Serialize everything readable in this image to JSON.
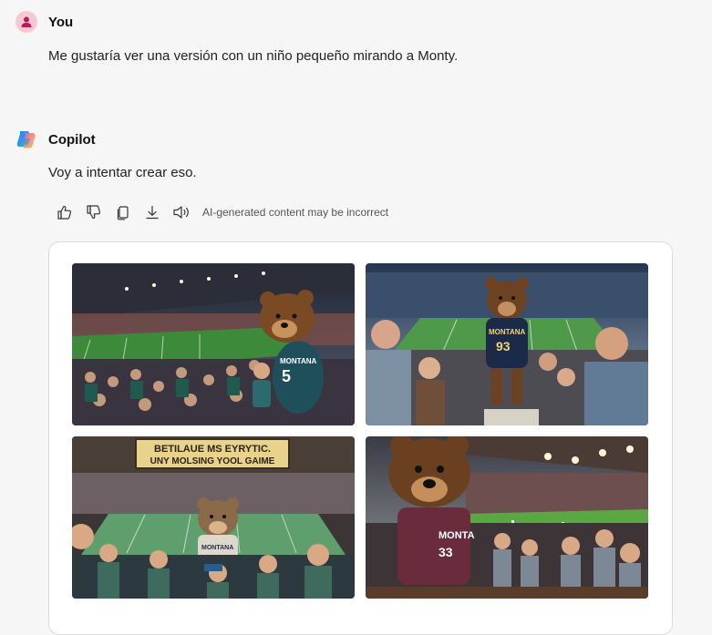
{
  "user_message": {
    "author": "You",
    "text": "Me gustaría ver una versión con un niño pequeño mirando a Monty."
  },
  "assistant_message": {
    "author": "Copilot",
    "text": "Voy a intentar crear eso.",
    "disclaimer": "AI-generated content may be incorrect",
    "actions": [
      "thumbs-up",
      "thumbs-down",
      "copy",
      "download",
      "read-aloud"
    ]
  },
  "images": {
    "img1": {
      "jersey_text": "MONTANA",
      "jersey_number": "5"
    },
    "img2": {
      "jersey_text": "MONTANA",
      "jersey_number": "93"
    },
    "img3": {
      "sign_line1": "BETILAUE MS EYRYTIC.",
      "sign_line2": "UNY MOLSING YOOL GAIME",
      "jersey_text": "MONTANA"
    },
    "img4": {
      "jersey_text": "MONTA",
      "jersey_number": "33"
    }
  },
  "colors": {
    "background": "#f6f6f6",
    "card_border": "#dcdcdc",
    "user_avatar": "#f4c9d2",
    "user_avatar_glyph": "#c2185b"
  }
}
